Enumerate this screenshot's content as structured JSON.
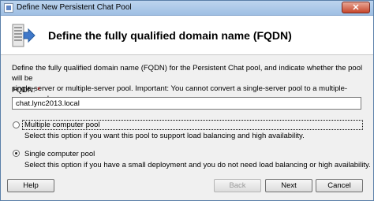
{
  "window": {
    "title": "Define New Persistent Chat Pool",
    "close_glyph": "✕"
  },
  "header": {
    "title": "Define the fully qualified domain name (FQDN)",
    "icon": "server-pool-icon"
  },
  "description": {
    "line1": "Define the fully qualified domain name (FQDN) for the Persistent Chat pool, and indicate whether the pool will be",
    "line2": "single-server or multiple-server pool. Important: You cannot convert a single-server pool to a multiple-server pool."
  },
  "fqdn": {
    "label": "FQDN:",
    "required_mark": "*",
    "value": "chat.lync2013.local"
  },
  "options": [
    {
      "label": "Multiple computer pool",
      "description": "Select this option if you want this pool to support load balancing and high availability.",
      "selected": false
    },
    {
      "label": "Single computer pool",
      "description": "Select this option if you have a small deployment and you do not need load balancing or high availability.",
      "selected": true
    }
  ],
  "buttons": {
    "help": "Help",
    "back": "Back",
    "next": "Next",
    "cancel": "Cancel"
  }
}
